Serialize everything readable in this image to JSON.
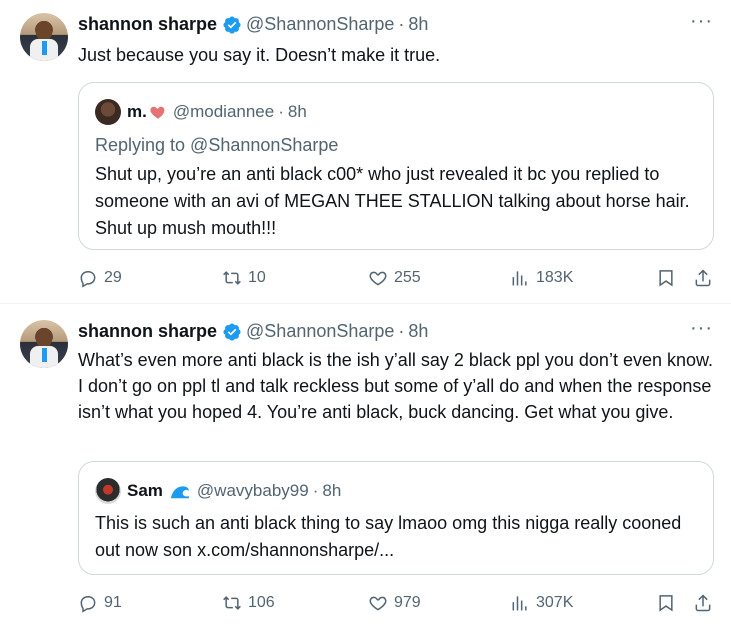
{
  "tweets": [
    {
      "author": {
        "name": "shannon sharpe",
        "handle": "@ShannonSharpe",
        "time": "8h"
      },
      "text": "Just because you say it. Doesn’t make it true.",
      "quote": {
        "name": "m.",
        "handle": "@modiannee",
        "time": "8h",
        "replying_to": "Replying to @ShannonSharpe",
        "text": "Shut up, you’re an anti black c00* who just revealed it bc you replied to someone with an avi of MEGAN THEE STALLION talking about horse hair. Shut up mush mouth!!!"
      },
      "stats": {
        "replies": "29",
        "reposts": "10",
        "likes": "255",
        "views": "183K"
      }
    },
    {
      "author": {
        "name": "shannon sharpe",
        "handle": "@ShannonSharpe",
        "time": "8h"
      },
      "text": "What’s even more anti black is the ish y’all say 2 black ppl you don’t even know. I don’t go on ppl tl and talk reckless but some of y’all do and when the response isn’t what you hoped 4. You’re anti black, buck dancing. Get what you give.",
      "quote": {
        "name": "Sam",
        "handle": "@wavybaby99",
        "time": "8h",
        "text": "This is such an anti black thing to say lmaoo omg this nigga really cooned out now son x.com/shannonsharpe/..."
      },
      "stats": {
        "replies": "91",
        "reposts": "106",
        "likes": "979",
        "views": "307K"
      }
    }
  ],
  "ui": {
    "separator": "·",
    "more": "···"
  },
  "colors": {
    "verified": "#1d9bf0",
    "secondary_text": "#536471",
    "border": "#cfd9de",
    "heart_emoji": "#e57373"
  },
  "icons": [
    "verified-badge-icon",
    "more-icon",
    "reply-icon",
    "repost-icon",
    "like-icon",
    "views-icon",
    "bookmark-icon",
    "share-icon",
    "heart-emoji-icon",
    "wave-emoji-icon"
  ]
}
